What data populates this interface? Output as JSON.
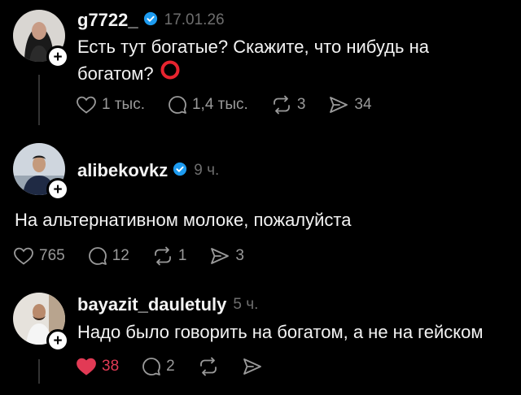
{
  "colors": {
    "background": "#000000",
    "verified": "#1d9bf0",
    "liked": "#e23a55",
    "muted": "#9a9a9a"
  },
  "posts": [
    {
      "username": "g7722_",
      "verified": true,
      "time": "17.01.26",
      "text_line1": "Есть тут богатые? Скажите, что нибудь на",
      "text_line2": "богатом?",
      "emoji": "red-circle",
      "likes": "1 тыс.",
      "comments": "1,4 тыс.",
      "reposts": "3",
      "shares": "34"
    },
    {
      "username": "alibekovkz",
      "verified": true,
      "time": "9 ч.",
      "text": "На альтернативном молоке, пожалуйста",
      "likes": "765",
      "comments": "12",
      "reposts": "1",
      "shares": "3"
    },
    {
      "username": "bayazit_dauletuly",
      "verified": false,
      "time": "5 ч.",
      "text": "Надо было говорить на богатом, а не на гейском",
      "likes": "38",
      "liked": true,
      "comments": "2",
      "reposts": "",
      "shares": ""
    }
  ]
}
